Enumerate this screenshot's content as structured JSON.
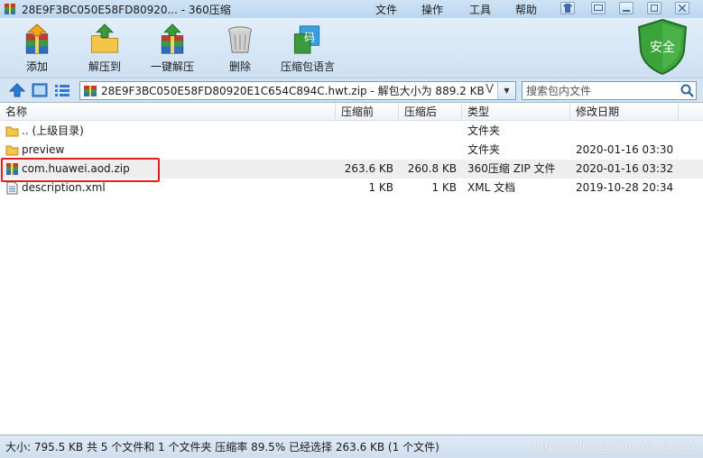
{
  "window": {
    "title": "28E9F3BC050E58FD80920... - 360压缩",
    "menus": [
      "文件",
      "操作",
      "工具",
      "帮助"
    ],
    "controls": [
      "skin-icon",
      "message-icon",
      "minimize-icon",
      "maximize-icon",
      "close-icon"
    ]
  },
  "toolbar": {
    "buttons": [
      "添加",
      "解压到",
      "一键解压",
      "删除",
      "压缩包语言"
    ],
    "security_label": "安全",
    "icon_lang_glyph": "码"
  },
  "addressbar": {
    "path": "28E9F3BC050E58FD80920E1C654C894C.hwt.zip - 解包大小为 889.2 KB",
    "v_mark": "V",
    "search_placeholder": "搜索包内文件"
  },
  "columns": [
    "名称",
    "压缩前",
    "压缩后",
    "类型",
    "修改日期"
  ],
  "rows": [
    {
      "name": ".. (上级目录)",
      "before": "",
      "after": "",
      "type": "文件夹",
      "date": "",
      "icon": "folder-icon"
    },
    {
      "name": "preview",
      "before": "",
      "after": "",
      "type": "文件夹",
      "date": "2020-01-16 03:30",
      "icon": "folder-icon"
    },
    {
      "name": "com.huawei.aod.zip",
      "before": "263.6 KB",
      "after": "260.8 KB",
      "type": "360压缩 ZIP 文件",
      "date": "2020-01-16 03:32",
      "icon": "zip-archive-icon"
    },
    {
      "name": "description.xml",
      "before": "1 KB",
      "after": "1 KB",
      "type": "XML 文档",
      "date": "2019-10-28 20:34",
      "icon": "xml-file-icon"
    }
  ],
  "statusbar": {
    "text": "大小: 795.5 KB 共 5 个文件和 1 个文件夹 压缩率 89.5% 已经选择 263.6 KB (1 个文件)",
    "watermark": "https://blog.csdn.net/l_canjnu"
  },
  "colors": {
    "highlight": "#e02020",
    "shield": "#3aa33a",
    "folder": "#f3c54a"
  }
}
